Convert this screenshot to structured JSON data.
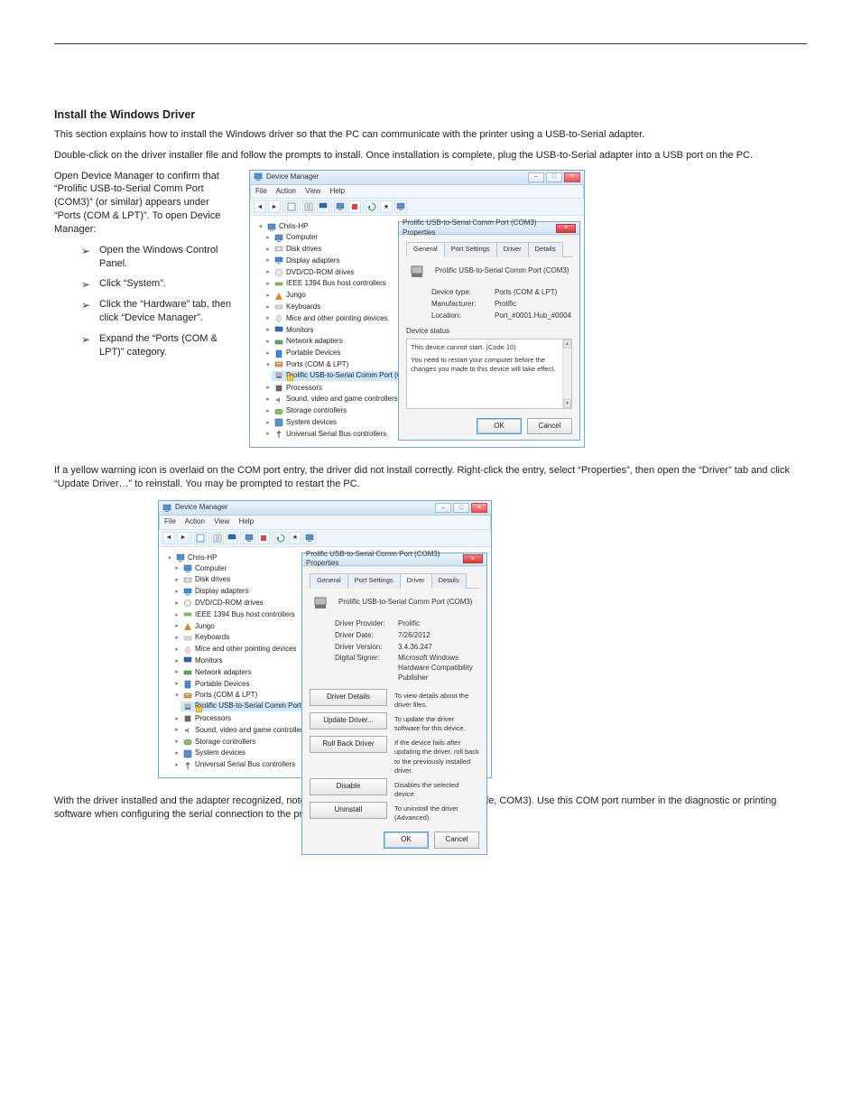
{
  "doc": {
    "heading_install": "Install the Windows Driver",
    "intro1": "This section explains how to install the Windows driver so that the PC can communicate with the printer using a USB-to-Serial adapter.",
    "intro2": "Double-click on the driver installer file and follow the prompts to install. Once installation is complete, plug the USB-to-Serial adapter into a USB port on the PC.",
    "intro3": "Open Device Manager to confirm that “Prolific USB-to-Serial Comm Port (COM3)” (or similar) appears under “Ports (COM & LPT)”. To open Device Manager:",
    "arrows": [
      "Open the Windows Control Panel.",
      "Click “System”.",
      "Click the “Hardware” tab, then click “Device Manager”.",
      "Expand the “Ports (COM & LPT)” category."
    ],
    "post1": "If a yellow warning icon is overlaid on the COM port entry, the driver did not install correctly. Right-click the entry, select “Properties”, then open the “Driver” tab and click “Update Driver…” to reinstall. You may be prompted to restart the PC.",
    "post2": "With the driver installed and the adapter recognized, note the COM port number shown (for example, COM3). Use this COM port number in the diagnostic or printing software when configuring the serial connection to the printer."
  },
  "devmgr": {
    "title": "Device Manager",
    "menus": [
      "File",
      "Action",
      "View",
      "Help"
    ],
    "root": "Chris-HP",
    "items": [
      {
        "label": "Computer",
        "icon": "computer"
      },
      {
        "label": "Disk drives",
        "icon": "disk"
      },
      {
        "label": "Display adapters",
        "icon": "display"
      },
      {
        "label": "DVD/CD-ROM drives",
        "icon": "dvd"
      },
      {
        "label": "IEEE 1394 Bus host controllers",
        "icon": "bus"
      },
      {
        "label": "Jungo",
        "icon": "jungo"
      },
      {
        "label": "Keyboards",
        "icon": "keyboard"
      },
      {
        "label": "Mice and other pointing devices",
        "icon": "mouse"
      },
      {
        "label": "Monitors",
        "icon": "monitor"
      },
      {
        "label": "Network adapters",
        "icon": "network"
      },
      {
        "label": "Portable Devices",
        "icon": "portable"
      }
    ],
    "ports_label": "Ports (COM & LPT)",
    "ports_child": "Prolific USB-to-Serial Comm Port (COM3)",
    "items_after": [
      {
        "label": "Processors",
        "icon": "processor"
      },
      {
        "label": "Sound, video and game controllers",
        "icon": "sound"
      },
      {
        "label": "Storage controllers",
        "icon": "storage"
      },
      {
        "label": "System devices",
        "icon": "system"
      },
      {
        "label": "Universal Serial Bus controllers",
        "icon": "usb"
      }
    ]
  },
  "prop_general": {
    "title": "Prolific USB-to-Serial Comm Port (COM3) Properties",
    "tabs": [
      "General",
      "Port Settings",
      "Driver",
      "Details"
    ],
    "device_name": "Prolific USB-to-Serial Comm Port (COM3)",
    "device_type_k": "Device type:",
    "device_type_v": "Ports (COM & LPT)",
    "manufacturer_k": "Manufacturer:",
    "manufacturer_v": "Prolific",
    "location_k": "Location:",
    "location_v": "Port_#0001.Hub_#0004",
    "status_head": "Device status",
    "status1": "This device cannot start. (Code 10)",
    "status2": "You need to restart your computer before the changes you made to this device will take effect.",
    "ok": "OK",
    "cancel": "Cancel"
  },
  "prop_driver": {
    "title": "Prolific USB-to-Serial Comm Port (COM3) Properties",
    "tabs": [
      "General",
      "Port Settings",
      "Driver",
      "Details"
    ],
    "device_name": "Prolific USB-to-Serial Comm Port (COM3)",
    "provider_k": "Driver Provider:",
    "provider_v": "Prolific",
    "date_k": "Driver Date:",
    "date_v": "7/26/2012",
    "version_k": "Driver Version:",
    "version_v": "3.4.36.247",
    "signer_k": "Digital Signer:",
    "signer_v": "Microsoft Windows Hardware Compatibility Publisher",
    "btn_details": "Driver Details",
    "btn_update": "Update Driver...",
    "btn_rollback": "Roll Back Driver",
    "btn_disable": "Disable",
    "btn_uninstall": "Uninstall",
    "desc_details": "To view details about the driver files.",
    "desc_update": "To update the driver software for this device.",
    "desc_rollback": "If the device fails after updating the driver, roll back to the previously installed driver.",
    "desc_disable": "Disables the selected device.",
    "desc_uninstall": "To uninstall the driver (Advanced).",
    "ok": "OK",
    "cancel": "Cancel"
  }
}
